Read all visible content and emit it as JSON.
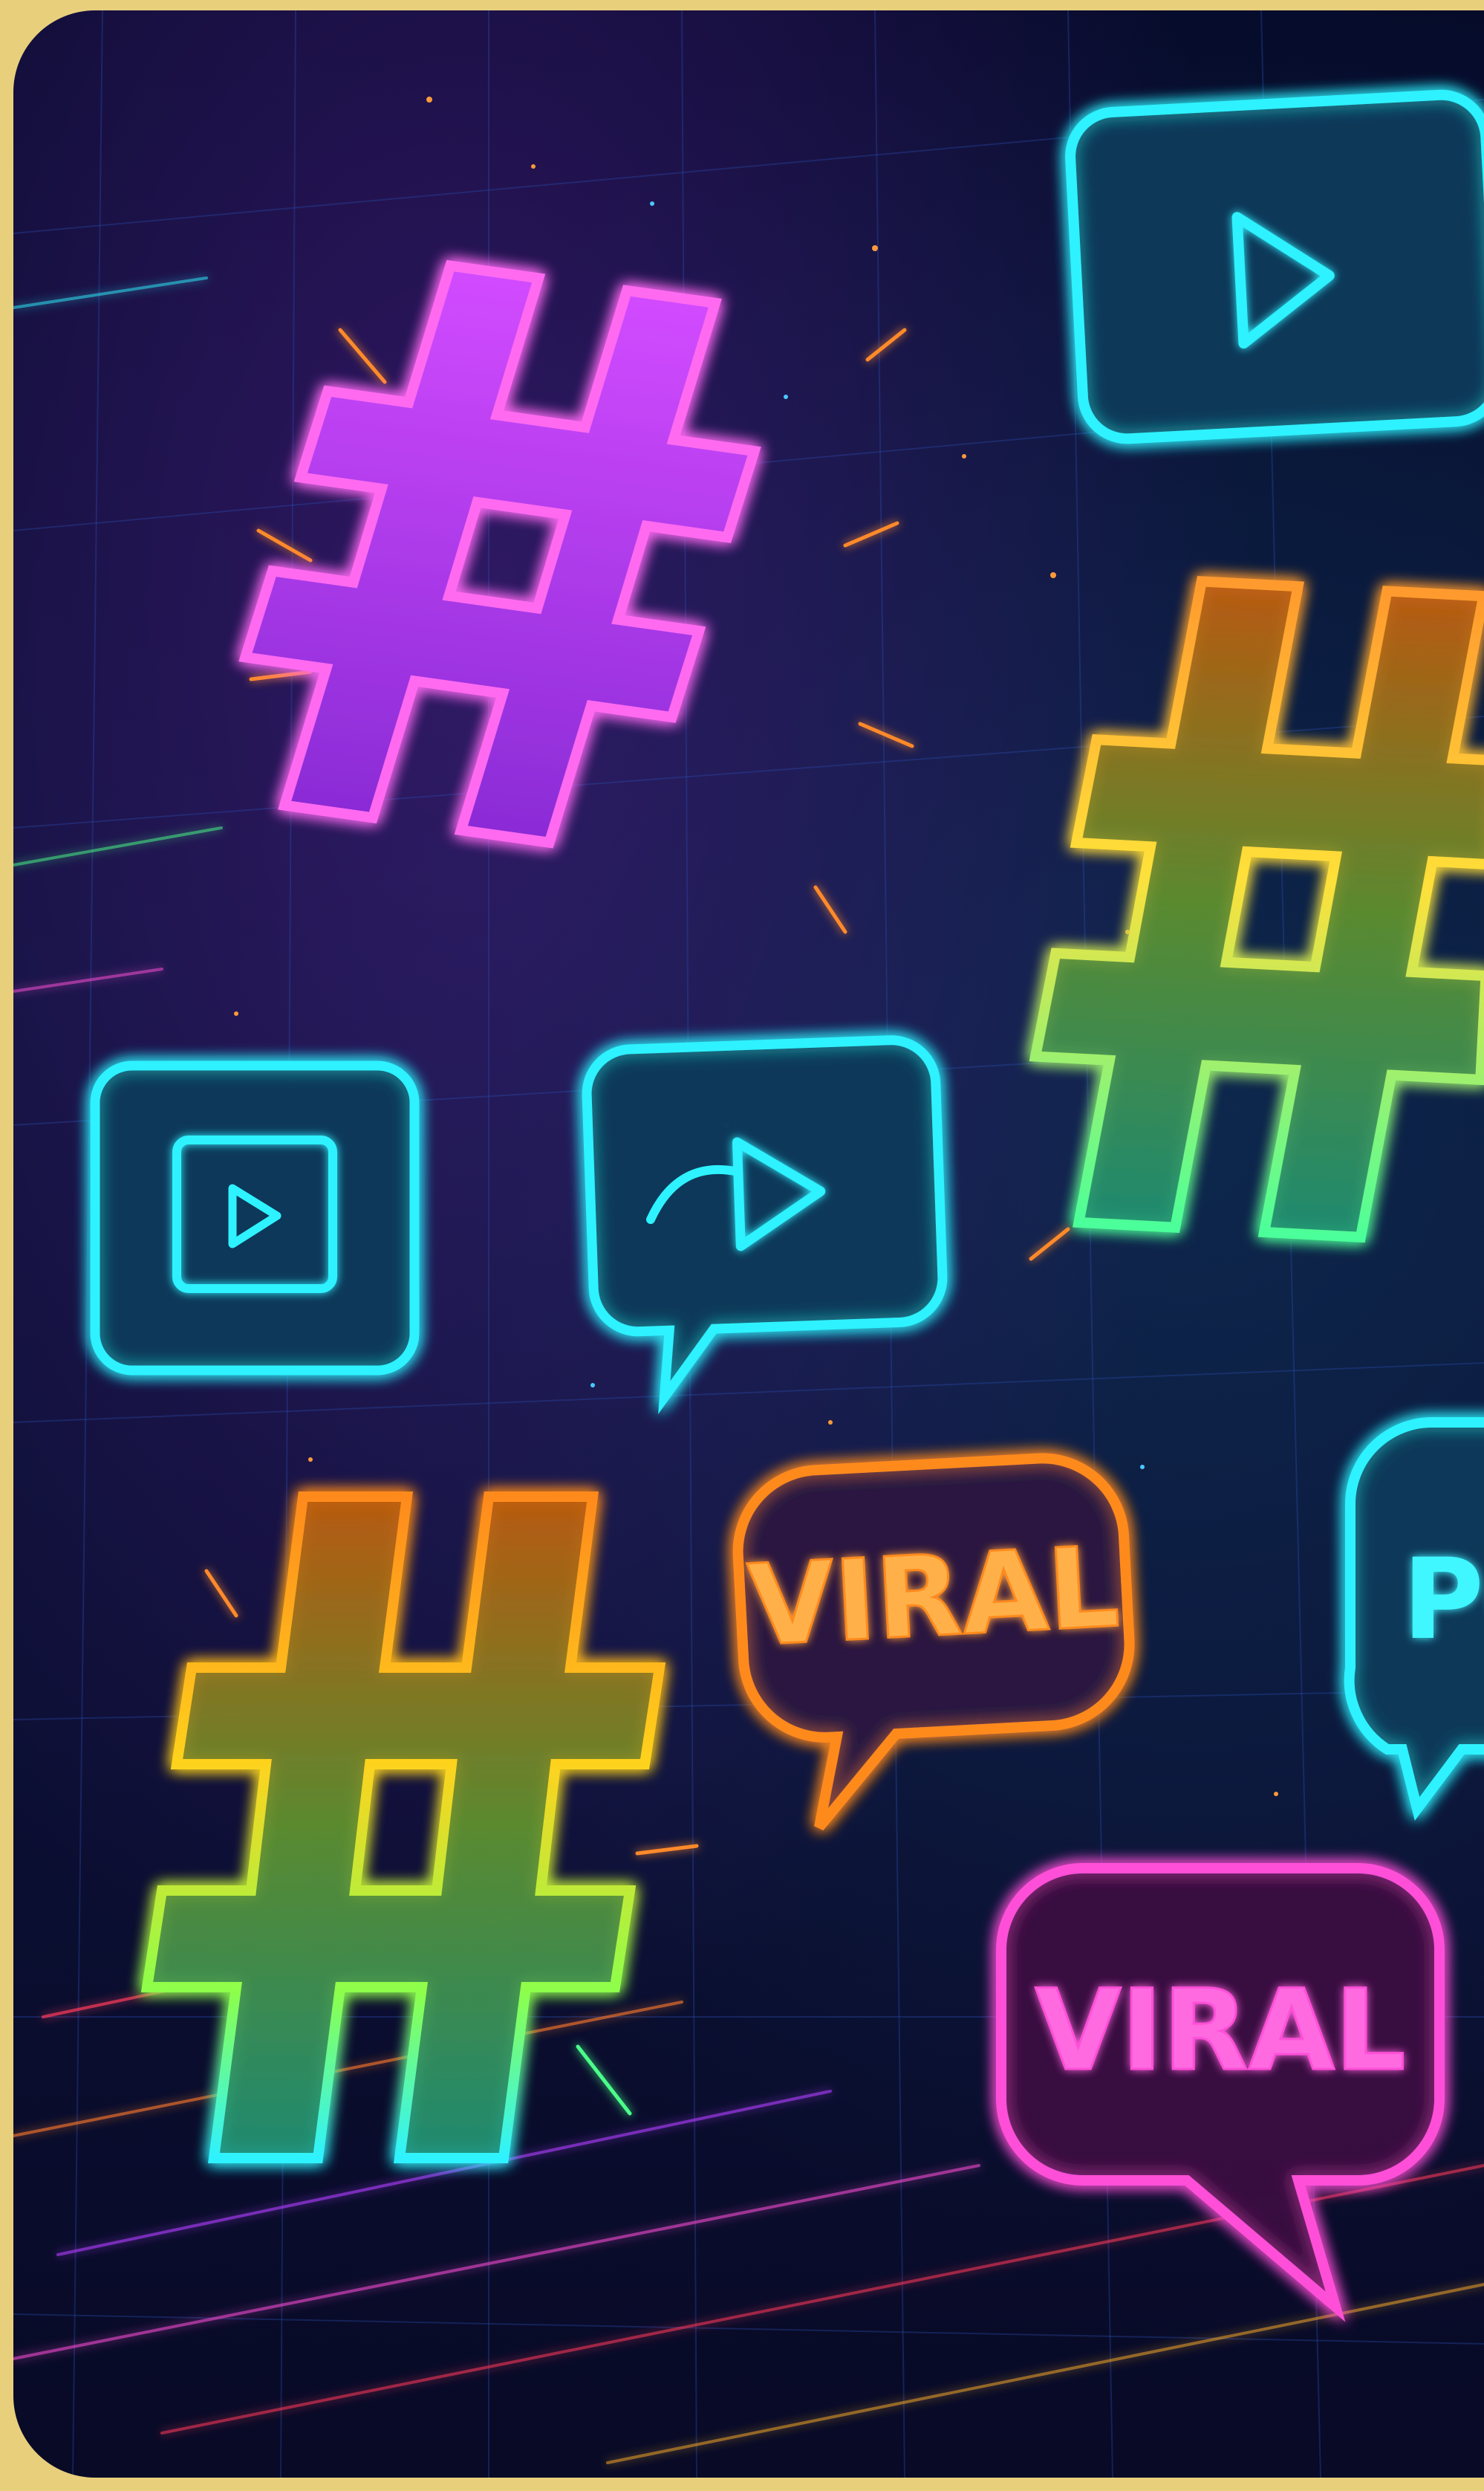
{
  "bubbles": {
    "orange_label": "VIRAL",
    "pink_label": "VIRAL",
    "cyan_partial_label": "PO"
  },
  "icons": {
    "hashtag": "hashtag-icon",
    "play": "play-button-icon"
  },
  "colors": {
    "frame": "#e8cf7c",
    "background": "#070c2c",
    "pink": "#ff4fd8",
    "purple": "#b03cff",
    "cyan": "#2ef2ff",
    "orange": "#ff8a1e",
    "yellow": "#ffd21e",
    "green": "#4cff8a"
  }
}
